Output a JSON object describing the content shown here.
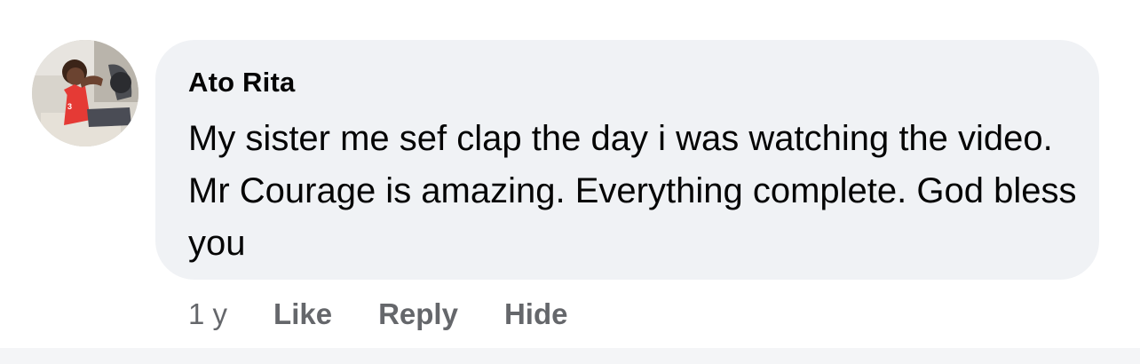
{
  "comment": {
    "author": "Ato Rita",
    "text": "My sister me sef clap the day i was watching the video. Mr Courage is amazing. Everything complete. God bless you",
    "timestamp": "1 y",
    "actions": {
      "like_label": "Like",
      "reply_label": "Reply",
      "hide_label": "Hide"
    }
  },
  "colors": {
    "bubble_background": "#f0f2f5",
    "primary_text": "#050505",
    "secondary_text": "#65676b",
    "page_background": "#ffffff"
  },
  "avatar": {
    "icon": "profile-photo"
  }
}
